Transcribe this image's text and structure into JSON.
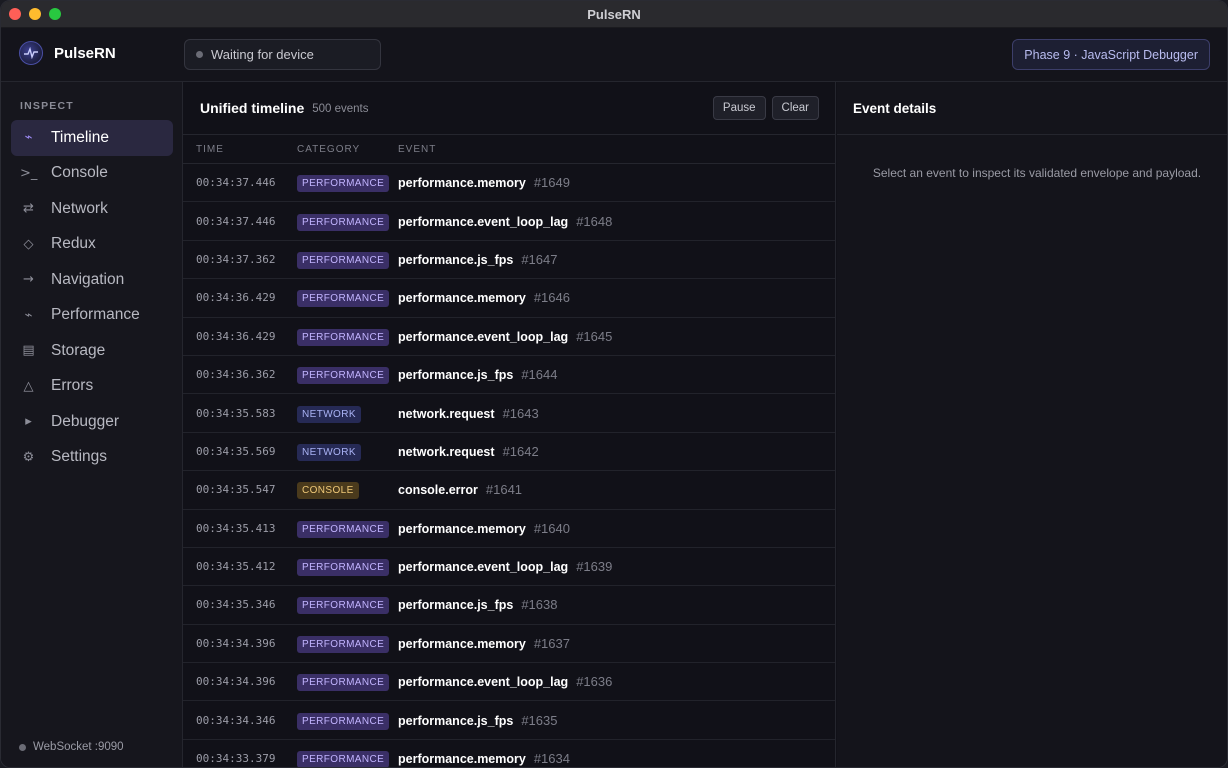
{
  "window": {
    "title": "PulseRN"
  },
  "header": {
    "brand": "PulseRN",
    "device_status": "Waiting for device",
    "phase_badge": "Phase 9 · JavaScript Debugger"
  },
  "sidebar": {
    "section_label": "INSPECT",
    "items": [
      {
        "label": "Timeline",
        "icon": "pulse-icon",
        "glyph": "⌁",
        "active": true
      },
      {
        "label": "Console",
        "icon": "terminal-icon",
        "glyph": ">_",
        "active": false
      },
      {
        "label": "Network",
        "icon": "arrows-exchange-icon",
        "glyph": "⇄",
        "active": false
      },
      {
        "label": "Redux",
        "icon": "diamond-icon",
        "glyph": "◇",
        "active": false
      },
      {
        "label": "Navigation",
        "icon": "arrow-right-icon",
        "glyph": "→",
        "active": false
      },
      {
        "label": "Performance",
        "icon": "pulse-icon",
        "glyph": "⌁",
        "active": false
      },
      {
        "label": "Storage",
        "icon": "storage-icon",
        "glyph": "▤",
        "active": false
      },
      {
        "label": "Errors",
        "icon": "warning-triangle-icon",
        "glyph": "△",
        "active": false
      },
      {
        "label": "Debugger",
        "icon": "play-icon",
        "glyph": "▸",
        "active": false
      },
      {
        "label": "Settings",
        "icon": "gear-icon",
        "glyph": "⚙",
        "active": false
      }
    ],
    "ws_status": "WebSocket :9090"
  },
  "timeline": {
    "title": "Unified timeline",
    "count": "500 events",
    "pause_label": "Pause",
    "clear_label": "Clear",
    "columns": {
      "time": "TIME",
      "category": "CATEGORY",
      "event": "EVENT"
    },
    "rows": [
      {
        "time": "00:34:37.446",
        "category": "PERFORMANCE",
        "event": "performance.memory",
        "id": "#1649"
      },
      {
        "time": "00:34:37.446",
        "category": "PERFORMANCE",
        "event": "performance.event_loop_lag",
        "id": "#1648"
      },
      {
        "time": "00:34:37.362",
        "category": "PERFORMANCE",
        "event": "performance.js_fps",
        "id": "#1647"
      },
      {
        "time": "00:34:36.429",
        "category": "PERFORMANCE",
        "event": "performance.memory",
        "id": "#1646"
      },
      {
        "time": "00:34:36.429",
        "category": "PERFORMANCE",
        "event": "performance.event_loop_lag",
        "id": "#1645"
      },
      {
        "time": "00:34:36.362",
        "category": "PERFORMANCE",
        "event": "performance.js_fps",
        "id": "#1644"
      },
      {
        "time": "00:34:35.583",
        "category": "NETWORK",
        "event": "network.request",
        "id": "#1643"
      },
      {
        "time": "00:34:35.569",
        "category": "NETWORK",
        "event": "network.request",
        "id": "#1642"
      },
      {
        "time": "00:34:35.547",
        "category": "CONSOLE",
        "event": "console.error",
        "id": "#1641"
      },
      {
        "time": "00:34:35.413",
        "category": "PERFORMANCE",
        "event": "performance.memory",
        "id": "#1640"
      },
      {
        "time": "00:34:35.412",
        "category": "PERFORMANCE",
        "event": "performance.event_loop_lag",
        "id": "#1639"
      },
      {
        "time": "00:34:35.346",
        "category": "PERFORMANCE",
        "event": "performance.js_fps",
        "id": "#1638"
      },
      {
        "time": "00:34:34.396",
        "category": "PERFORMANCE",
        "event": "performance.memory",
        "id": "#1637"
      },
      {
        "time": "00:34:34.396",
        "category": "PERFORMANCE",
        "event": "performance.event_loop_lag",
        "id": "#1636"
      },
      {
        "time": "00:34:34.346",
        "category": "PERFORMANCE",
        "event": "performance.js_fps",
        "id": "#1635"
      },
      {
        "time": "00:34:33.379",
        "category": "PERFORMANCE",
        "event": "performance.memory",
        "id": "#1634"
      }
    ]
  },
  "details": {
    "title": "Event details",
    "empty_message": "Select an event to inspect its validated envelope and payload."
  },
  "colors": {
    "accent": "#9f8cf7",
    "performance_bg": "#3a2f66",
    "performance_fg": "#c2b4ff",
    "network_bg": "#262a55",
    "network_fg": "#aab3f5",
    "console_bg": "#4a3a1c",
    "console_fg": "#f0c978"
  }
}
